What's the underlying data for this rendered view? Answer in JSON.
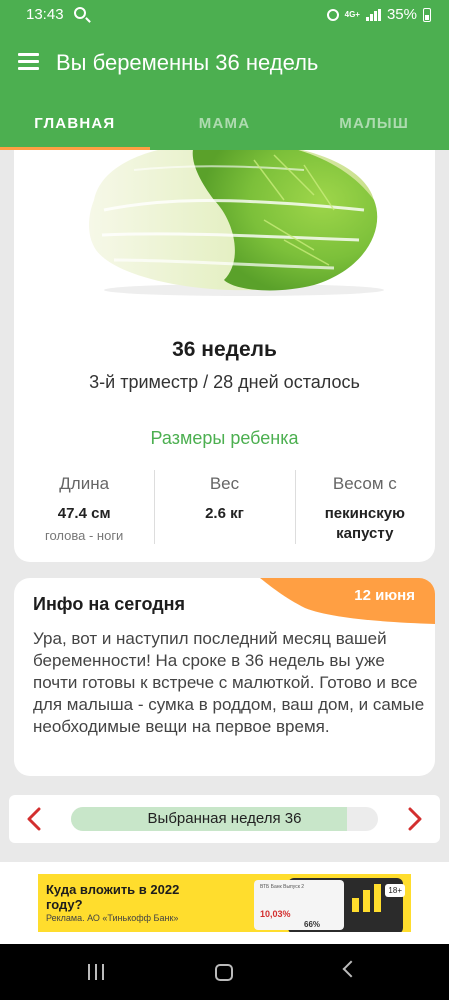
{
  "status_bar": {
    "time": "13:43",
    "network": "4G+",
    "battery": "35%"
  },
  "app_bar": {
    "title": "Вы беременны 36 недель"
  },
  "tabs": [
    {
      "label": "ГЛАВНАЯ",
      "active": true
    },
    {
      "label": "МАМА",
      "active": false
    },
    {
      "label": "МАЛЫШ",
      "active": false
    }
  ],
  "main_card": {
    "image": "napa-cabbage",
    "week_title": "36 недель",
    "trimester": "3-й триместр / 28 дней осталось",
    "sizes_link": "Размеры ребенка",
    "stats": [
      {
        "label": "Длина",
        "value": "47.4 см",
        "sub": "голова - ноги"
      },
      {
        "label": "Вес",
        "value": "2.6 кг",
        "sub": ""
      },
      {
        "label": "Весом с",
        "value": "пекинскую капусту",
        "sub": ""
      }
    ]
  },
  "info_card": {
    "title": "Инфо на сегодня",
    "date": "12 июня",
    "text": "Ура, вот и наступил последний месяц вашей беременности! На сроке в 36 недель вы уже почти готовы к встрече с малюткой. Готово и все для малыша - сумка в роддом, ваш дом, и самые необходимые вещи на первое время."
  },
  "week_selector": {
    "label": "Выбранная неделя 36",
    "progress": 0.9
  },
  "ad": {
    "headline": "Куда вложить в 2022 году?",
    "disclaimer": "Реклама. АО «Тинькофф Банк»",
    "age": "18+",
    "card_text": "ВТБ Банк Выпуск 2",
    "rate": "10,03%",
    "rate2": "66%"
  },
  "colors": {
    "primary": "#4caf50",
    "accent": "#ff9f43",
    "arrow": "#d32f2f"
  }
}
